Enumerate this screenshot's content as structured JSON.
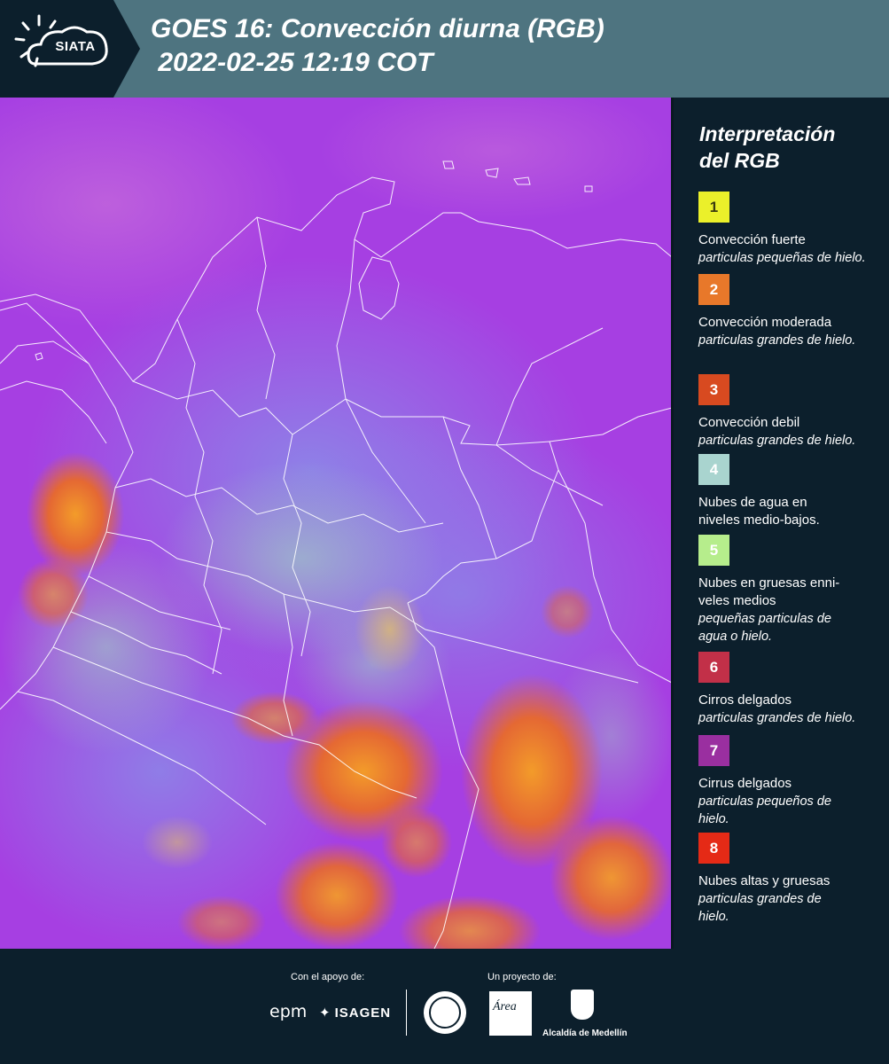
{
  "header": {
    "logo_text": "SIATA",
    "title_line1": "GOES 16: Convección diurna (RGB)",
    "title_line2": " 2022-02-25 12:19 COT"
  },
  "legend": {
    "title_line1": "Interpretación",
    "title_line2": "del RGB",
    "items": [
      {
        "num": "1",
        "color": "#ebf02a",
        "text_color": "#3a3a10",
        "name": "Convección fuerte",
        "sub": "particulas pequeñas de hielo."
      },
      {
        "num": "2",
        "color": "#e8782a",
        "text_color": "#ffffff",
        "name": "Convección moderada",
        "sub": "particulas grandes de hielo."
      },
      {
        "num": "3",
        "color": "#d84a20",
        "text_color": "#ffffff",
        "name": "Convección debil",
        "sub": "particulas grandes de hielo."
      },
      {
        "num": "4",
        "color": "#a9d4cf",
        "text_color": "#ffffff",
        "name": "Nubes de agua en niveles medio-bajos.",
        "sub": ""
      },
      {
        "num": "5",
        "color": "#b6ed8c",
        "text_color": "#ffffff",
        "name": "Nubes en gruesas enni-veles medios",
        "sub": "pequeñas particulas de agua o hielo."
      },
      {
        "num": "6",
        "color": "#c23048",
        "text_color": "#ffffff",
        "name": "Cirros delgados",
        "sub": "particulas grandes de hielo."
      },
      {
        "num": "7",
        "color": "#9a2fa0",
        "text_color": "#ffffff",
        "name": "Cirrus delgados",
        "sub": "particulas pequeños de hielo."
      },
      {
        "num": "8",
        "color": "#e52a16",
        "text_color": "#ffffff",
        "name": "Nubes altas y gruesas",
        "sub": "particulas grandes de hielo."
      }
    ]
  },
  "footer": {
    "support_label": "Con el apoyo de:",
    "project_label": "Un proyecto de:",
    "sponsor1": "epm",
    "sponsor2": "ISAGEN",
    "partner_amva": "Área",
    "partner_medellin": "Alcaldía de Medellín"
  }
}
